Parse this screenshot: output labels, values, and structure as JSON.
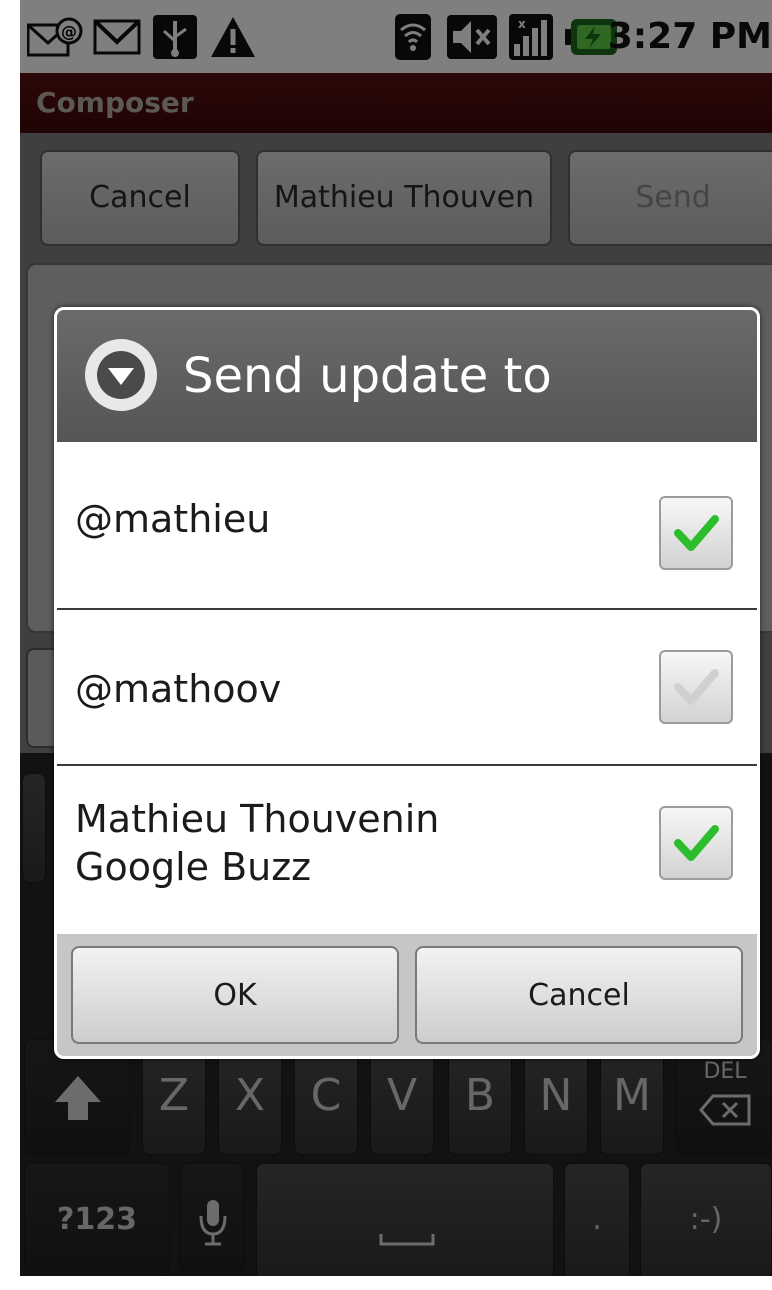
{
  "status_bar": {
    "time": "3:27 PM",
    "icons": [
      "at-mail-icon",
      "gmail-icon",
      "usb-icon",
      "warning-icon",
      "wifi-icon",
      "mute-icon",
      "signal-icon",
      "battery-charging-icon"
    ]
  },
  "app": {
    "title": "Composer"
  },
  "composer": {
    "cancel_label": "Cancel",
    "account_label": "Mathieu Thouven",
    "send_label": "Send"
  },
  "dialog": {
    "title": "Send update to",
    "options": [
      {
        "label": "@mathieu",
        "checked": true
      },
      {
        "label": "@mathoov",
        "checked": false
      },
      {
        "label_line1": "Mathieu Thouvenin",
        "label_line2": "Google Buzz",
        "checked": true
      }
    ],
    "ok_label": "OK",
    "cancel_label": "Cancel"
  },
  "keyboard": {
    "row3": [
      "Z",
      "X",
      "C",
      "V",
      "B",
      "N",
      "M"
    ],
    "del_label": "DEL",
    "symbols_label": "?123",
    "period_label": ".",
    "smiley_label": ":-)"
  },
  "colors": {
    "title_bar": "#4a0c0c",
    "check_green": "#2bbd2b",
    "dialog_header": "#5f5f5f"
  }
}
